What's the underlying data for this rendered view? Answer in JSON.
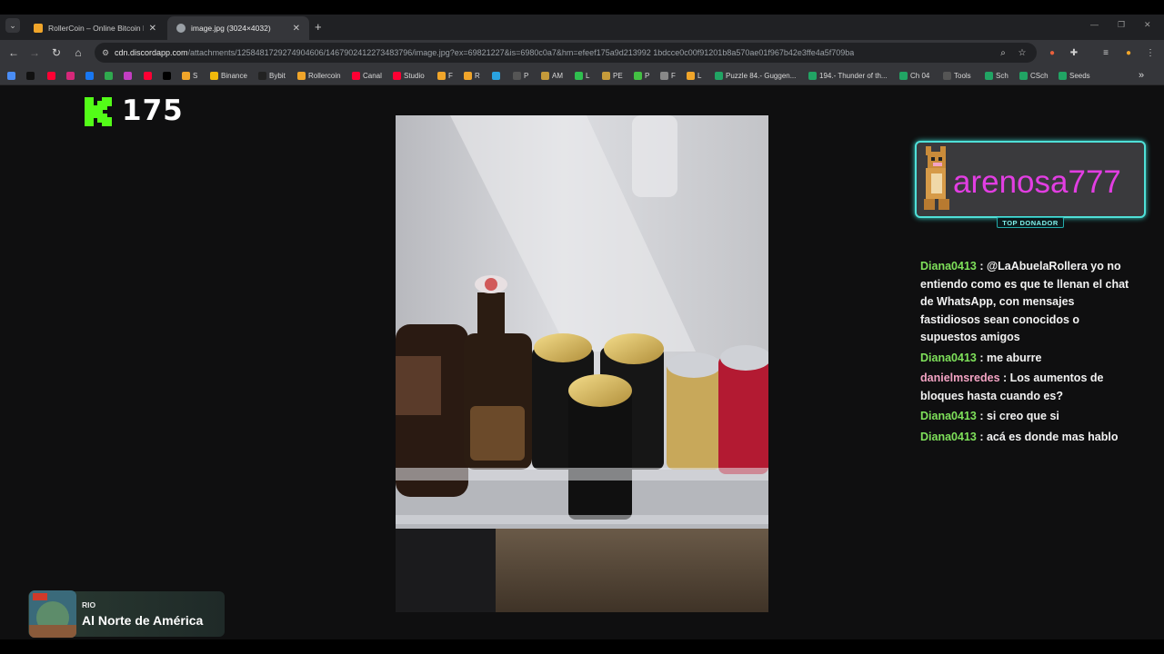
{
  "browser": {
    "tabs": [
      {
        "title": "RollerCoin – Online Bitcoin Mini",
        "active": false
      },
      {
        "title": "image.jpg (3024×4032)",
        "active": true
      }
    ],
    "url_host": "cdn.discordapp.com",
    "url_rest": "/attachments/1258481729274904606/1467902412273483796/image.jpg?ex=69821227&is=6980c0a7&hm=efeef175a9d213992 1bdcce0c00f91201b8a570ae01f967b42e3ffe4a5f709ba"
  },
  "bookmarks": [
    {
      "label": "",
      "icon": "globe-icon",
      "color": "#4a8df5"
    },
    {
      "label": "",
      "icon": "threads-icon",
      "color": "#111111"
    },
    {
      "label": "",
      "icon": "youtube-icon",
      "color": "#ff0033"
    },
    {
      "label": "",
      "icon": "instagram-icon",
      "color": "#d6287a"
    },
    {
      "label": "",
      "icon": "facebook-icon",
      "color": "#1877f2"
    },
    {
      "label": "",
      "icon": "drive-icon",
      "color": "#2fa94e"
    },
    {
      "label": "",
      "icon": "app-icon",
      "color": "#c23ec2"
    },
    {
      "label": "",
      "icon": "youtube-icon",
      "color": "#ff0033"
    },
    {
      "label": "",
      "icon": "x-icon",
      "color": "#000000"
    },
    {
      "label": "S",
      "icon": "rollercoin-icon",
      "color": "#f0a52a"
    },
    {
      "label": "Binance",
      "icon": "binance-icon",
      "color": "#f0b90b"
    },
    {
      "label": "Bybit",
      "icon": "bybit-icon",
      "color": "#222222"
    },
    {
      "label": "Rollercoin",
      "icon": "rollercoin-icon",
      "color": "#f0a52a"
    },
    {
      "label": "Canal",
      "icon": "youtube-icon",
      "color": "#ff0033"
    },
    {
      "label": "Studio",
      "icon": "youtube-icon",
      "color": "#ff0033"
    },
    {
      "label": "F",
      "icon": "smiley-icon",
      "color": "#f0a52a"
    },
    {
      "label": "R",
      "icon": "smiley-icon",
      "color": "#f0a52a"
    },
    {
      "label": "",
      "icon": "telegram-icon",
      "color": "#2aa3e0"
    },
    {
      "label": "P",
      "icon": "folder-icon",
      "color": "#555555"
    },
    {
      "label": "AM",
      "icon": "tool-icon",
      "color": "#c59a3a"
    },
    {
      "label": "L",
      "icon": "app-icon",
      "color": "#2fbf4f"
    },
    {
      "label": "PE",
      "icon": "tool-icon",
      "color": "#c59a3a"
    },
    {
      "label": "P",
      "icon": "app-icon",
      "color": "#43c043"
    },
    {
      "label": "F",
      "icon": "gear-icon",
      "color": "#888888"
    },
    {
      "label": "L",
      "icon": "smiley-icon",
      "color": "#f0a52a"
    },
    {
      "label": "Puzzle 84.- Guggen...",
      "icon": "sheets-icon",
      "color": "#21a464"
    },
    {
      "label": "194.- Thunder of th...",
      "icon": "sheets-icon",
      "color": "#21a464"
    },
    {
      "label": "Ch 04",
      "icon": "sheets-icon",
      "color": "#21a464"
    },
    {
      "label": "Tools",
      "icon": "folder-icon",
      "color": "#555555"
    },
    {
      "label": "Sch",
      "icon": "sheets-icon",
      "color": "#21a464"
    },
    {
      "label": "CSch",
      "icon": "sheets-icon",
      "color": "#21a464"
    },
    {
      "label": "Seeds",
      "icon": "sheets-icon",
      "color": "#21a464"
    }
  ],
  "overlay": {
    "kick_count": "175",
    "top_donor_name": "arenosa777",
    "top_donor_label": "TOP DONADOR",
    "accent_color": "#4fe0d8",
    "donor_name_color": "#e23ee2"
  },
  "chat": [
    {
      "user": "Diana0413",
      "text": "@LaAbuelaRollera yo no entiendo como es que te llenan el chat de WhatsApp, con mensajes fastidiosos sean conocidos o supuestos amigos",
      "user_color": "#7ee05a"
    },
    {
      "user": "Diana0413",
      "text": "me aburre",
      "user_color": "#7ee05a"
    },
    {
      "user": "danielmsredes",
      "text": "Los aumentos de bloques hasta cuando es?",
      "user_color": "#f3a3c3"
    },
    {
      "user": "Diana0413",
      "text": "si creo que si",
      "user_color": "#7ee05a"
    },
    {
      "user": "Diana0413",
      "text": "acá es donde mas hablo",
      "user_color": "#7ee05a"
    }
  ],
  "now_playing": {
    "artist": "RIO",
    "title": "Al Norte de América"
  }
}
